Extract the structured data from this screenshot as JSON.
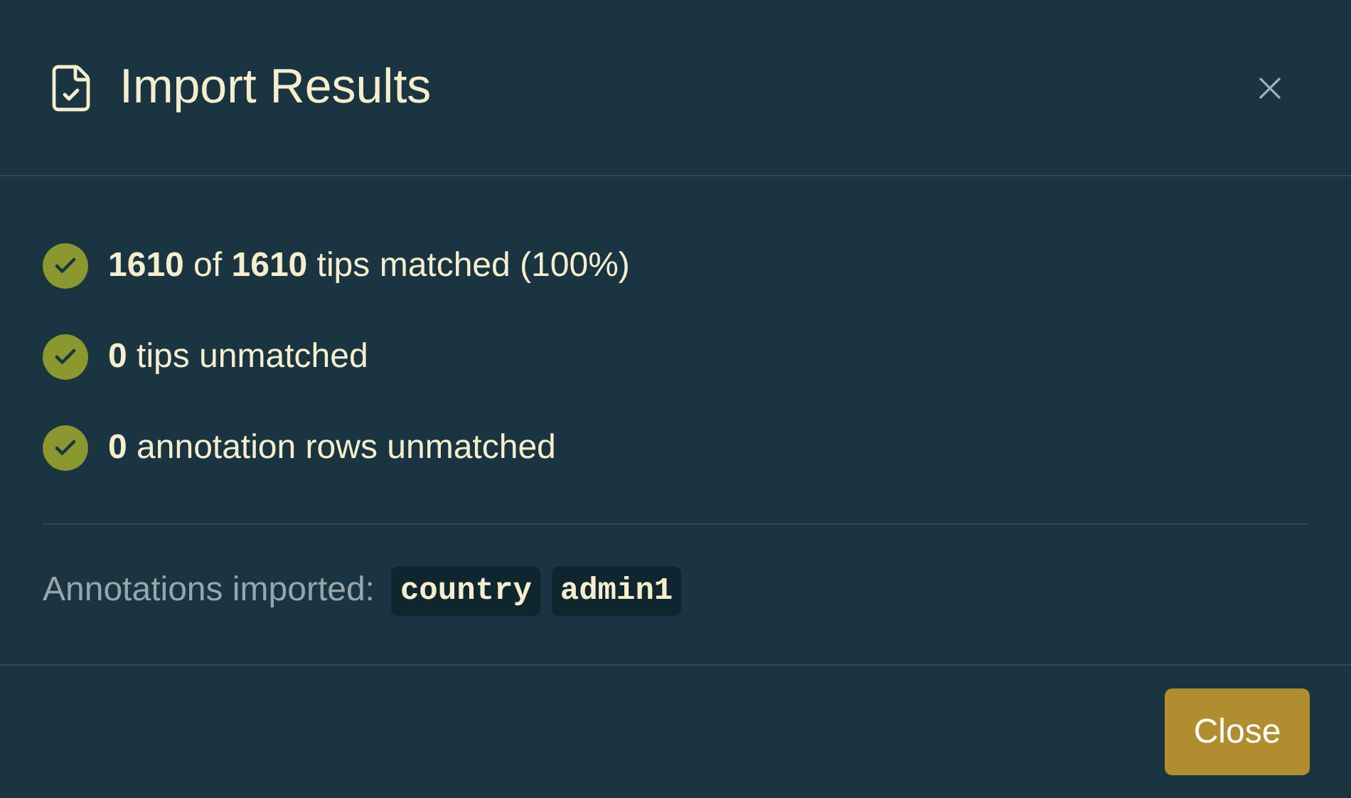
{
  "dialog": {
    "title": "Import Results",
    "results": [
      {
        "text": "**1610** of **1610** tips matched (100%)",
        "ok": true
      },
      {
        "text": "**0** tips unmatched",
        "ok": true
      },
      {
        "text": "**0** annotation rows unmatched",
        "ok": true
      }
    ],
    "annotations_label": "Annotations imported:",
    "annotations": [
      "country",
      "admin1"
    ],
    "buttons": [
      "Close"
    ]
  }
}
